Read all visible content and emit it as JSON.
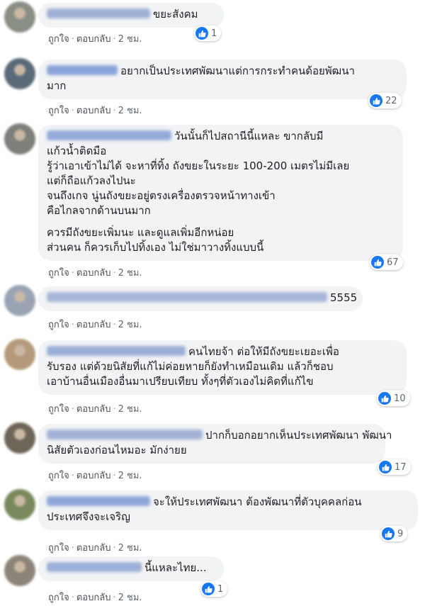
{
  "actions": {
    "like": "ถูกใจ",
    "reply": "ตอบกลับ",
    "separator": "·"
  },
  "colors": {
    "like_blue": "#1877f2",
    "bubble_bg": "#f2f3f5",
    "meta_gray": "#606770"
  },
  "comments": [
    {
      "text_lines": [
        "ขยะสังคม"
      ],
      "time": "2 ชม.",
      "like_count": "1"
    },
    {
      "text_lines": [
        "อยากเป็นประเทศพัฒนาแต่การกระทำคนด้อยพัฒนา",
        "มาก"
      ],
      "time": "2 ชม.",
      "like_count": "22"
    },
    {
      "text_lines": [
        "วันนั้นก็ไปสถานีนี้แหละ ขากลับมี",
        "แก้วน้ำติดมือ",
        "รู้ว่าเอาเข้าไม่ได้ จะหาที่ทิ้ง ถังขยะในระยะ 100-200 เมตรไม่มีเลย",
        "แต่ก็ถือแก้วลงไปนะ",
        "จนถึงเกจ นู่นถังขยะอยู่ตรงเครื่องตรวจหน้าทางเข้า",
        "คือไกลจากด้านบนมาก",
        "",
        "ควรมีถังขยะเพิ่มนะ และดูแลเพิ่มอีกหน่อย",
        "ส่วนคน ก็ควรเก็บไปทิ้งเอง ไม่ใช่มาวางทิ้งแบบนี้"
      ],
      "time": "2 ชม.",
      "like_count": "67"
    },
    {
      "text_lines": [
        "5555"
      ],
      "time": "2 ชม.",
      "like_count": ""
    },
    {
      "text_lines": [
        "คนไทยจ้า ต่อให้มีถังขยะเยอะเพื่อ",
        "รับรอง แต่ด้วยนิสัยที่แก้ไม่ค่อยหายก็ยังทำเหมือนเดิม แล้วก็ชอบ",
        "เอาบ้านอื่นเมืองอื่นมาเปรียบเทียบ ทั้งๆที่ตัวเองไม่คิดที่แก้ไข"
      ],
      "time": "2 ชม.",
      "like_count": "10"
    },
    {
      "text_lines": [
        "ปากก็บอกอยากเห็นประเทศพัฒนา พัฒนา",
        "นิสัยตัวเองก่อนไหมอะ มักง่ายย"
      ],
      "time": "2 ชม.",
      "like_count": "17"
    },
    {
      "text_lines": [
        "จะให้ประเทศพัฒนา ต้องพัฒนาที่ตัวบุคคลก่อน",
        "ประเทศจึงจะเจริญ"
      ],
      "time": "2 ชม.",
      "like_count": "9"
    },
    {
      "text_lines": [
        "นี้แหละไทย..."
      ],
      "time": "2 ชม.",
      "like_count": "1"
    }
  ]
}
